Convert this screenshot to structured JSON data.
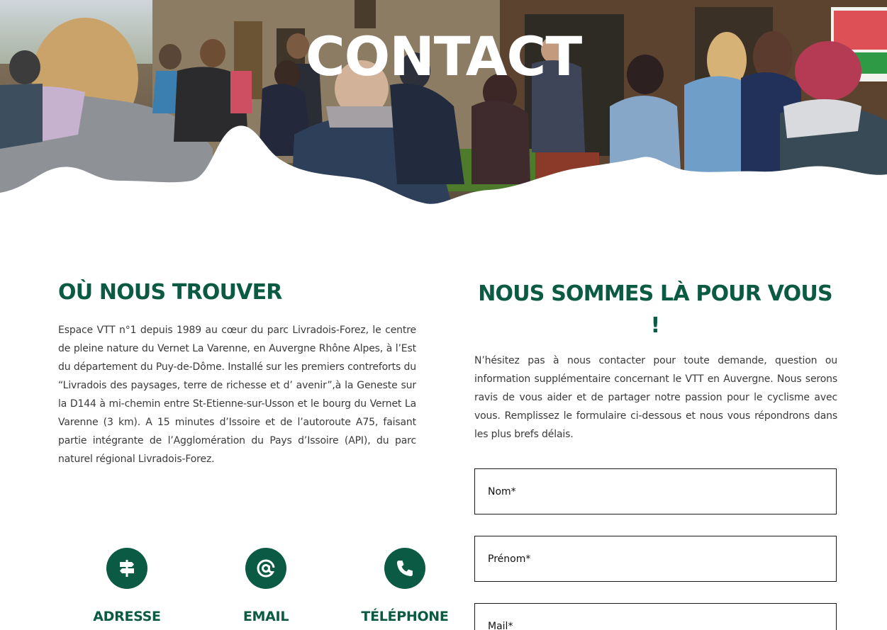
{
  "hero": {
    "title": "CONTACT"
  },
  "location": {
    "title": "OÙ NOUS TROUVER",
    "text": "Espace VTT n°1 depuis 1989 au cœur du parc Livradois-Forez,  le centre de pleine nature du Vernet La Varenne, en Auvergne Rhône Alpes, à l’Est du département du Puy-de-Dôme. Installé sur les premiers contreforts du “Livradois des paysages, terre de richesse et d’ avenir”,à la Geneste sur la D144 à mi-chemin entre St-Etienne-sur-Usson et le bourg du Vernet La Varenne (3 km). A 15 minutes d’Issoire et de l’autoroute A75, faisant partie intégrante de l’Agglomération du Pays d’Issoire (API), du parc naturel régional Livradois-Forez."
  },
  "contact_items": [
    {
      "label": "ADRESSE",
      "icon": "signpost-icon"
    },
    {
      "label": "EMAIL",
      "icon": "at-icon"
    },
    {
      "label": "TÉLÉPHONE",
      "icon": "phone-icon"
    }
  ],
  "form_section": {
    "title": "NOUS SOMMES LÀ POUR VOUS !",
    "text": "N’hésitez pas à nous contacter pour toute demande, question ou information supplémentaire concernant le VTT en Auvergne. Nous serons ravis de vous aider et de partager notre passion pour le cyclisme avec vous. Remplissez le formulaire ci-dessous et nous vous répondrons dans les plus brefs délais.",
    "fields": {
      "nom_placeholder": "Nom*",
      "prenom_placeholder": "Prénom*",
      "mail_placeholder": "Mail*"
    }
  },
  "colors": {
    "brand_green": "#0b5a43",
    "text": "#3a3a3a"
  }
}
